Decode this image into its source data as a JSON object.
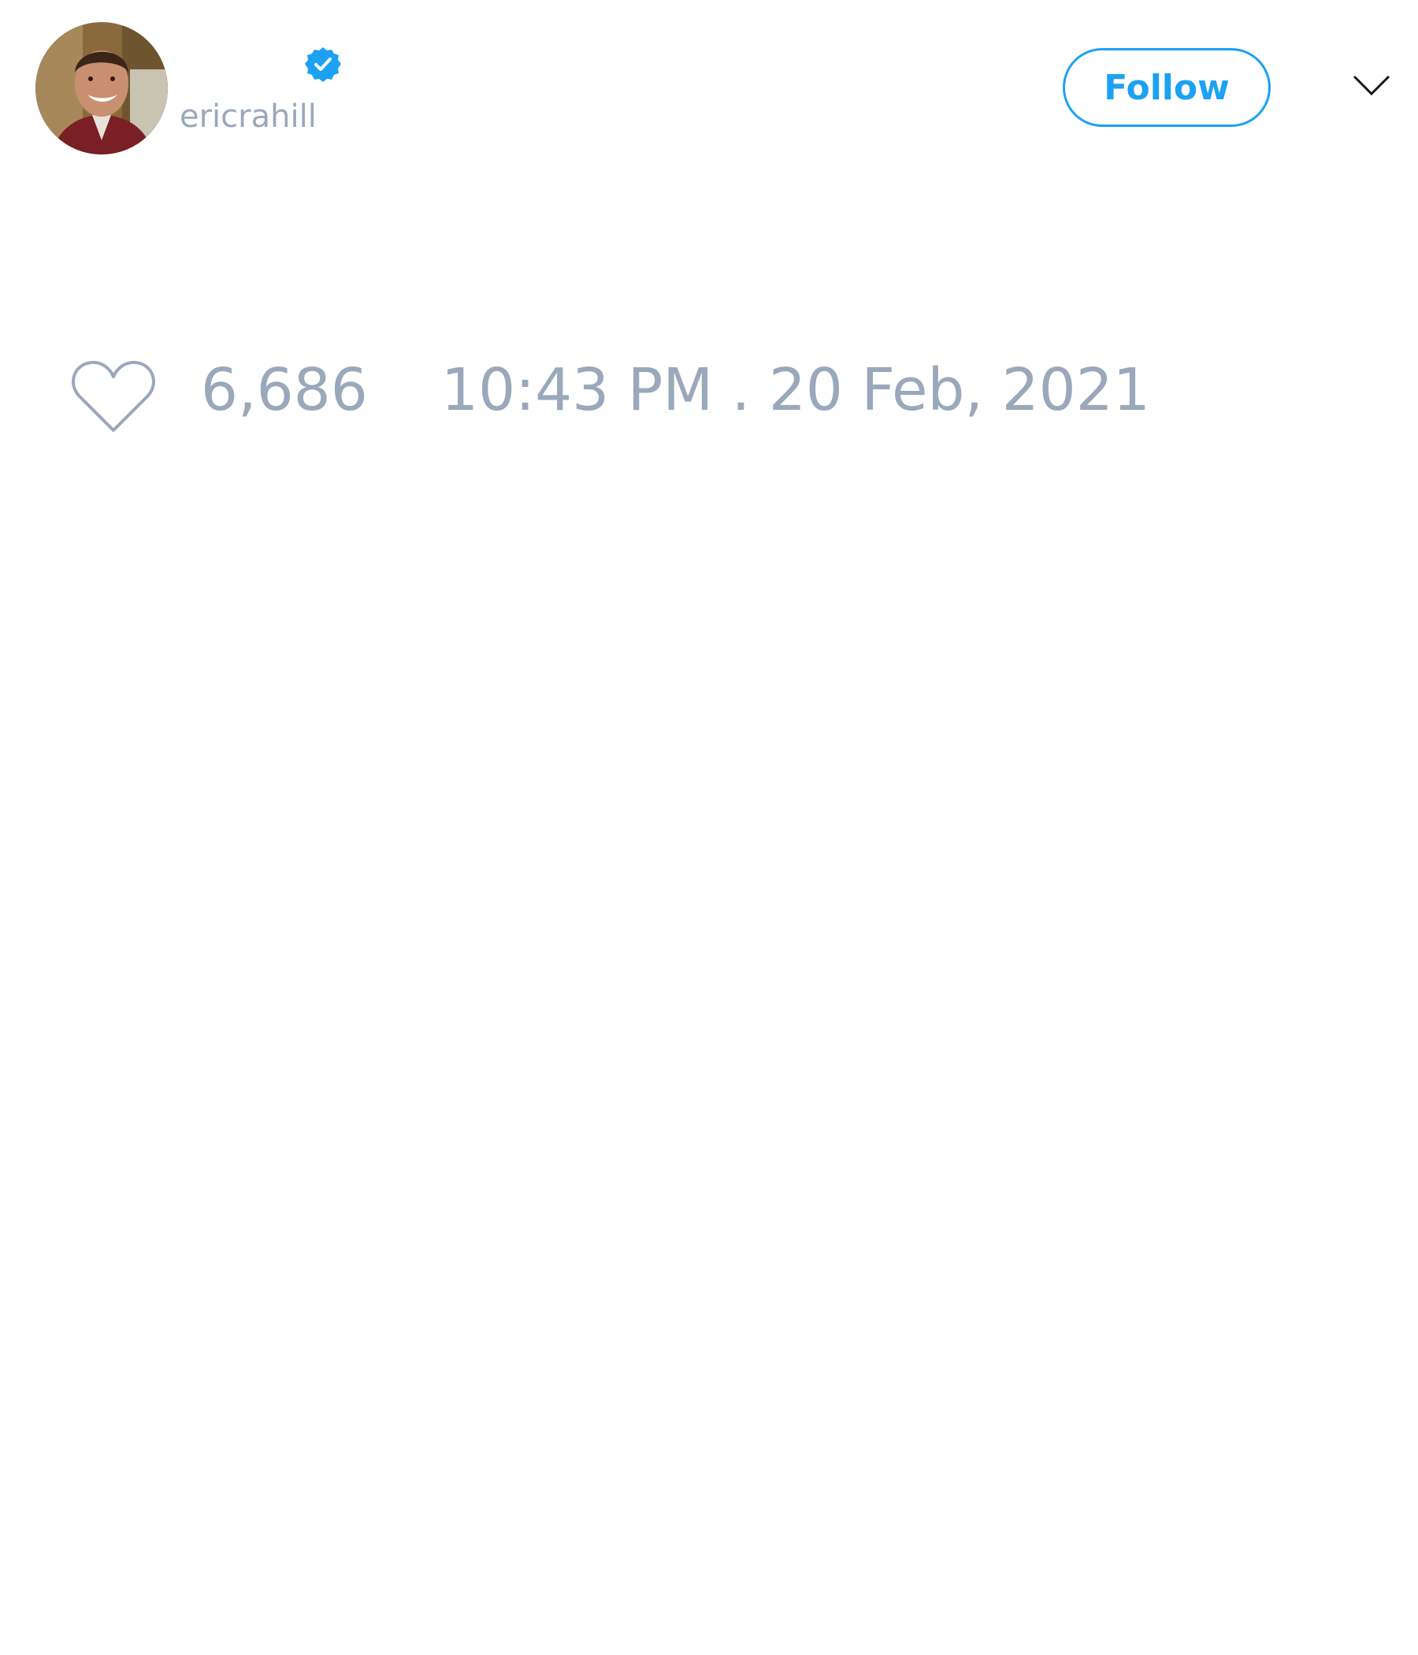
{
  "tweet": {
    "author": {
      "display_name": "",
      "username": "ericrahill",
      "verified": true
    },
    "follow_label": "Follow",
    "likes": "6,686",
    "timestamp": "10:43 PM . 20 Feb, 2021"
  },
  "icons": {
    "verified": "verified-badge-icon",
    "menu": "chevron-down-icon",
    "like": "heart-icon"
  },
  "colors": {
    "accent": "#1da1f2",
    "muted_text": "#9aa8bb",
    "background": "#ffffff"
  }
}
